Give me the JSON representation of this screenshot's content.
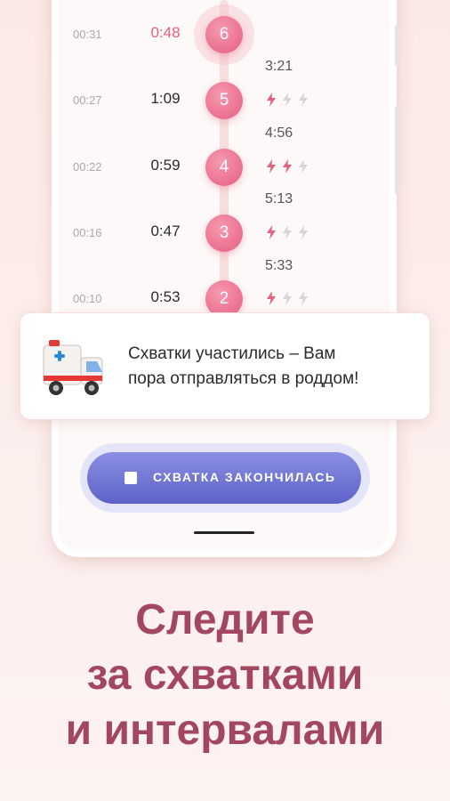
{
  "timeline": [
    {
      "time": "00:31",
      "duration": "0:48",
      "number": "6",
      "active": true,
      "intensity": 0
    },
    {
      "time": "00:27",
      "duration": "1:09",
      "number": "5",
      "active": false,
      "intensity": 1
    },
    {
      "time": "00:22",
      "duration": "0:59",
      "number": "4",
      "active": false,
      "intensity": 2
    },
    {
      "time": "00:16",
      "duration": "0:47",
      "number": "3",
      "active": false,
      "intensity": 1
    },
    {
      "time": "00:10",
      "duration": "0:53",
      "number": "2",
      "active": false,
      "intensity": 1
    }
  ],
  "intervals": [
    "3:21",
    "4:56",
    "5:13",
    "5:33"
  ],
  "notification": {
    "icon": "ambulance-icon",
    "line1": "Схватки участились – Вам",
    "line2": "пора отправляться в роддом!"
  },
  "action_button": {
    "label": "СХВАТКА ЗАКОНЧИЛАСЬ",
    "icon": "stop-icon"
  },
  "headline": {
    "line1": "Следите",
    "line2": "за схватками",
    "line3": "и интервалами"
  },
  "colors": {
    "accent_pink": "#e4607f",
    "bolt_inactive": "#d6d6d6",
    "button": "#5d62c8",
    "headline": "#a2475e"
  }
}
